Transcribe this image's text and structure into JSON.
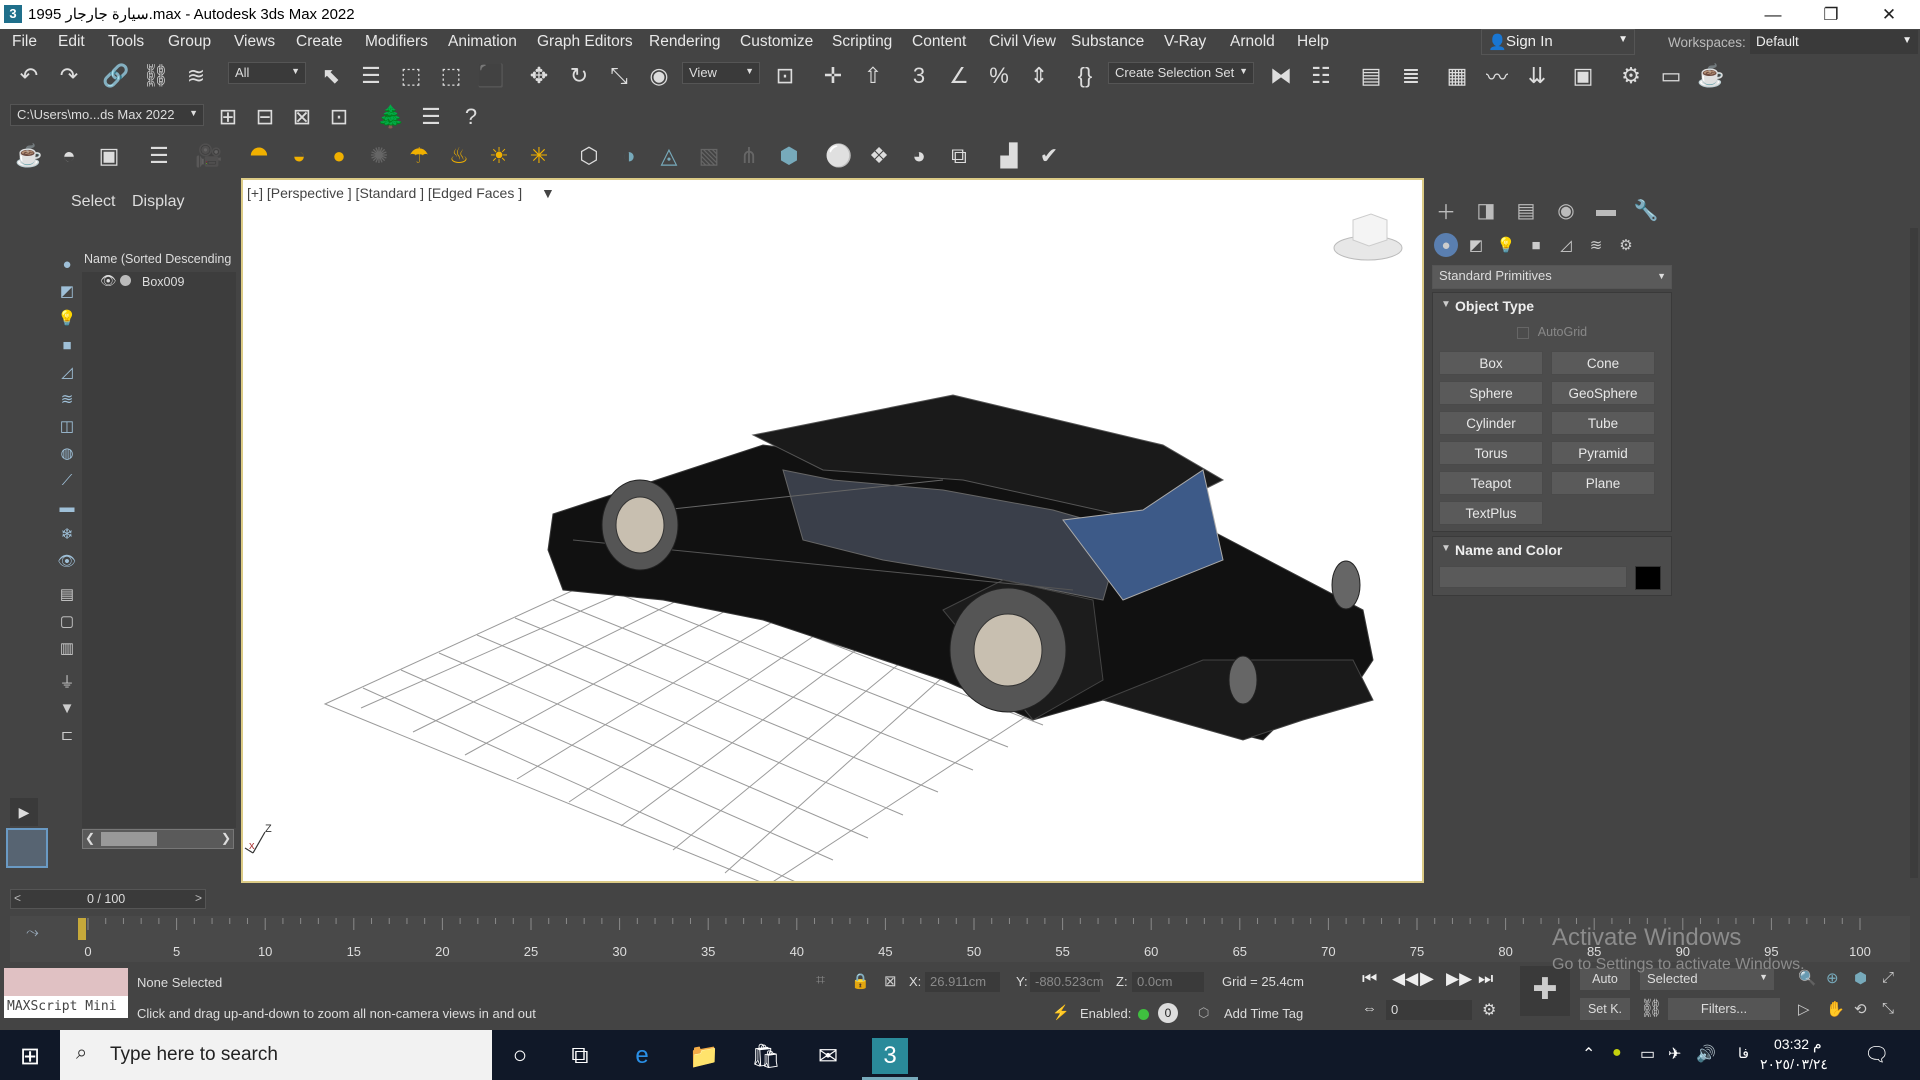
{
  "window": {
    "title": "سيارة جارجار 1995.max - Autodesk 3ds Max 2022",
    "app_icon": "3",
    "minimize": "—",
    "maximize": "❐",
    "close": "✕"
  },
  "menu": [
    "File",
    "Edit",
    "Tools",
    "Group",
    "Views",
    "Create",
    "Modifiers",
    "Animation",
    "Graph Editors",
    "Rendering",
    "Customize",
    "Scripting",
    "Content",
    "Civil View",
    "Substance",
    "V-Ray",
    "Arnold",
    "Help"
  ],
  "account": {
    "sign_in": "Sign In",
    "workspaces_label": "Workspaces:",
    "workspace": "Default"
  },
  "toolbar": {
    "filter": "All",
    "ref_coord": "View",
    "selection_set": "Create Selection Set",
    "project_path": "C:\\Users\\mo...ds Max 2022"
  },
  "scene_explorer": {
    "tabs": [
      "Select",
      "Display"
    ],
    "header": "Name (Sorted Descending",
    "items": [
      {
        "name": "Box009"
      }
    ]
  },
  "viewport": {
    "label": "[+] [Perspective ] [Standard ] [Edged Faces ]",
    "axis_z": "Z",
    "axis_x": "x",
    "background": "#ffffff",
    "border_color": "#dccb86"
  },
  "command_panel": {
    "category": "Standard Primitives",
    "object_type": {
      "title": "Object Type",
      "autogrid": "AutoGrid",
      "buttons": [
        "Box",
        "Cone",
        "Sphere",
        "GeoSphere",
        "Cylinder",
        "Tube",
        "Torus",
        "Pyramid",
        "Teapot",
        "Plane",
        "TextPlus"
      ]
    },
    "name_and_color": {
      "title": "Name and Color",
      "name_value": "",
      "color": "#000000"
    }
  },
  "timeline": {
    "frame_display": "0 / 100",
    "prev": "<",
    "next": ">",
    "ticks": [
      "0",
      "5",
      "10",
      "15",
      "20",
      "25",
      "30",
      "35",
      "40",
      "45",
      "50",
      "55",
      "60",
      "65",
      "70",
      "75",
      "80",
      "85",
      "90",
      "95",
      "100"
    ]
  },
  "status": {
    "selection": "None Selected",
    "prompt": "Click and drag up-and-down to zoom all non-camera views in and out",
    "maxscript": "MAXScript Mini",
    "x_label": "X:",
    "x_value": "26.911cm",
    "y_label": "Y:",
    "y_value": "-880.523cm",
    "z_label": "Z:",
    "z_value": "0.0cm",
    "grid": "Grid = 25.4cm",
    "enabled_label": "Enabled:",
    "add_time_tag": "Add Time Tag",
    "auto_key": "Auto",
    "set_key": "Set K.",
    "key_mode": "Selected",
    "filters": "Filters...",
    "frame_value": "0"
  },
  "watermark": {
    "line1": "Activate Windows",
    "line2": "Go to Settings to activate Windows."
  },
  "taskbar": {
    "search_placeholder": "Type here to search",
    "time": "03:32 م",
    "date": "٢٠٢٥/٠٣/٢٤",
    "lang": "فا"
  }
}
